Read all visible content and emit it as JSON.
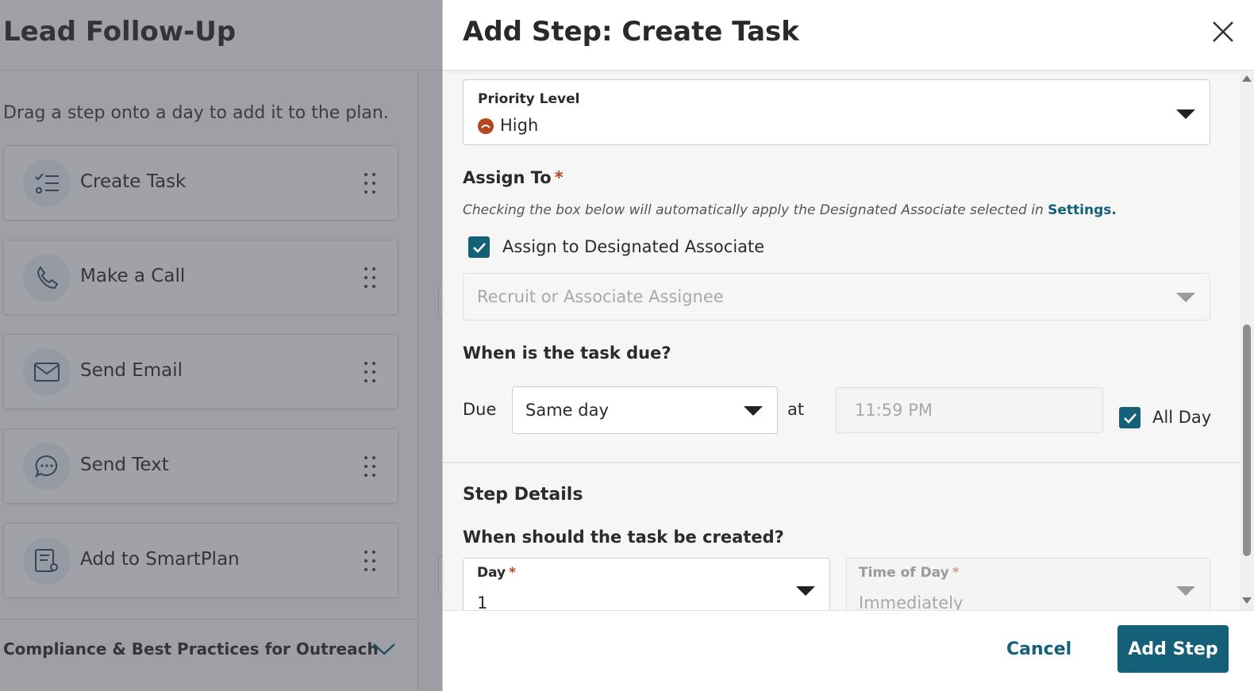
{
  "background": {
    "title": "Lead Follow-Up",
    "hint": "Drag a step onto a day to add it to the plan.",
    "steps": [
      {
        "label": "Create Task",
        "icon": "task-list-icon"
      },
      {
        "label": "Make a Call",
        "icon": "phone-icon"
      },
      {
        "label": "Send Email",
        "icon": "envelope-icon"
      },
      {
        "label": "Send Text",
        "icon": "chat-bubble-icon"
      },
      {
        "label": "Add to SmartPlan",
        "icon": "smartplan-icon"
      }
    ],
    "compliance": "Compliance & Best Practices for Outreach"
  },
  "drawer": {
    "title": "Add Step: Create Task",
    "priority": {
      "label": "Priority Level",
      "value": "High",
      "color": "#b5471f"
    },
    "assign": {
      "heading": "Assign To",
      "required_mark": "*",
      "help_text": "Checking the box below will automatically apply the Designated Associate selected in",
      "help_link": "Settings.",
      "checkbox_label": "Assign to Designated Associate",
      "checkbox_checked": true,
      "assignee_placeholder": "Recruit or Associate Assignee"
    },
    "due": {
      "heading": "When is the task due?",
      "due_label": "Due",
      "due_value": "Same day",
      "at_label": "at",
      "time_value": "11:59  PM",
      "all_day_label": "All Day",
      "all_day_checked": true
    },
    "step_details": {
      "heading": "Step Details",
      "created_heading": "When should the task be created?",
      "day_label": "Day",
      "day_value": "1",
      "time_of_day_label": "Time of Day",
      "time_of_day_value": "Immediately"
    },
    "footer": {
      "cancel_label": "Cancel",
      "add_label": "Add Step"
    }
  },
  "colors": {
    "primary": "#156079",
    "required": "#b5471f"
  }
}
